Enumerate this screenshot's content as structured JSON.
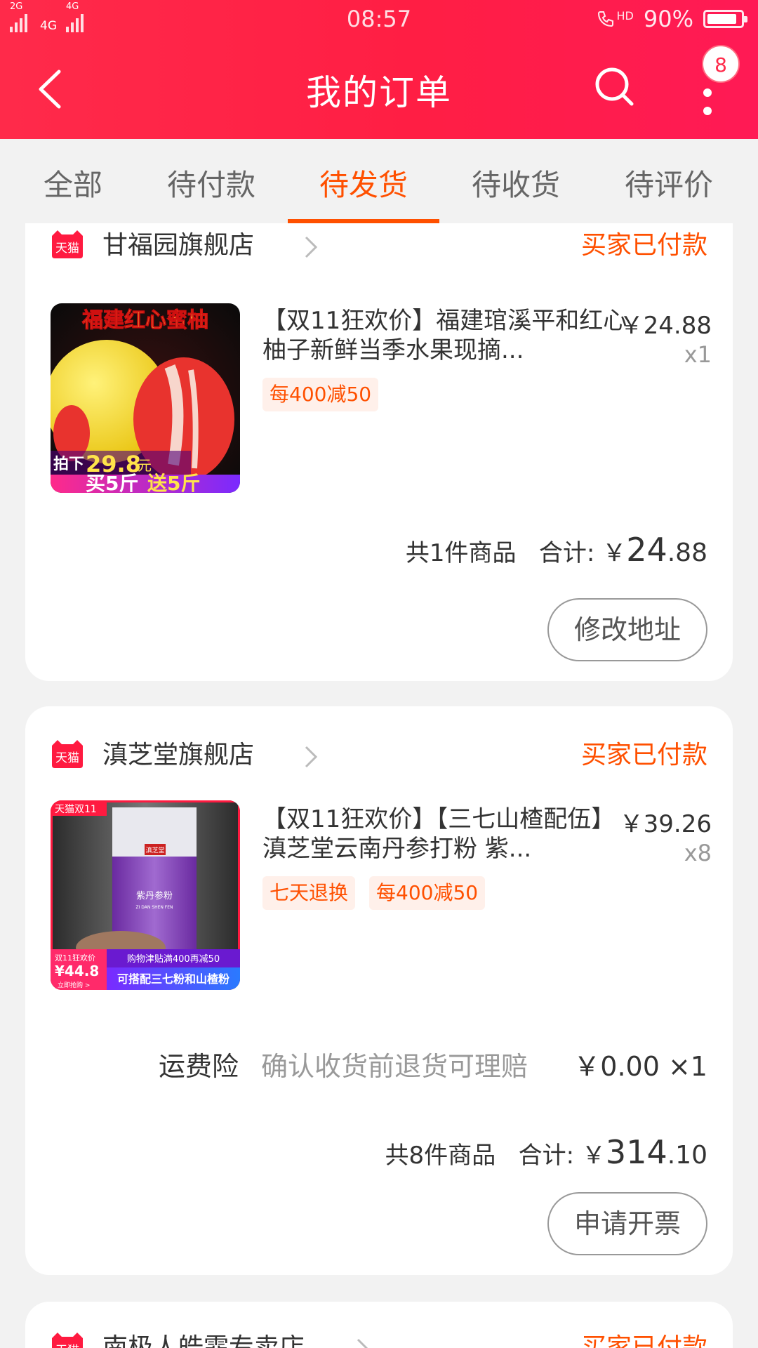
{
  "status_bar": {
    "network1": "2G",
    "network2": "4G",
    "network3": "4G",
    "time": "08:57",
    "call_hd": "HD",
    "battery_level": 0.9,
    "battery_text": "90%"
  },
  "nav": {
    "title": "我的订单",
    "badge_count": "8"
  },
  "tabs": [
    {
      "label": "全部",
      "active": false
    },
    {
      "label": "待付款",
      "active": false
    },
    {
      "label": "待发货",
      "active": true
    },
    {
      "label": "待收货",
      "active": false
    },
    {
      "label": "待评价",
      "active": false
    }
  ],
  "orders": [
    {
      "platform_logo": "天猫",
      "shop_name": "甘福园旗舰店",
      "status": "买家已付款",
      "item": {
        "title": "【双11狂欢价】福建琯溪平和红心柚子新鲜当季水果现摘...",
        "price": "￥24.88",
        "qty": "x1",
        "tags": [
          "每400减50"
        ],
        "image_text": {
          "headline": "福建红心蜜柚",
          "line1": "拍下",
          "line1_price": "29.8",
          "line1_unit": "元",
          "line2a": "买5斤",
          "line2b": "送5斤"
        }
      },
      "summary": {
        "count_text": "共1件商品",
        "total_label": "合计:",
        "currency": "￥",
        "total_int": "24",
        "total_dec": ".88"
      },
      "action": "修改地址"
    },
    {
      "platform_logo": "天猫",
      "shop_name": "滇芝堂旗舰店",
      "status": "买家已付款",
      "item": {
        "title": "【双11狂欢价】【三七山楂配伍】滇芝堂云南丹参打粉 紫...",
        "price": "￥39.26",
        "qty": "x8",
        "tags": [
          "七天退换",
          "每400减50"
        ],
        "image_text": {
          "corner": "天猫双11",
          "brand": "滇芝堂",
          "product": "紫丹参粉",
          "product_en": "ZI DAN SHEN FEN",
          "promo_label": "双11狂欢价",
          "promo_price": "¥44.8",
          "promo_buy": "立即抢购 >",
          "banner1": "购物津贴满400再减50",
          "banner2": "可搭配三七粉和山楂粉"
        }
      },
      "insurance": {
        "label": "运费险",
        "desc": "确认收货前退货可理赔",
        "price": "￥0.00 ×1"
      },
      "summary": {
        "count_text": "共8件商品",
        "total_label": "合计:",
        "currency": "￥",
        "total_int": "314",
        "total_dec": ".10"
      },
      "action": "申请开票"
    },
    {
      "platform_logo": "天猫",
      "shop_name": "南极人皓霏专卖店",
      "status": "买家已付款"
    }
  ],
  "colors": {
    "header_red": "#ff2448",
    "accent_orange": "#ff5000",
    "tag_bg": "#fff0ea",
    "page_bg": "#f2f2f2"
  },
  "icons": [
    "back-arrow-icon",
    "search-icon",
    "more-vertical-icon",
    "tmall-logo-icon",
    "chevron-right-icon"
  ]
}
